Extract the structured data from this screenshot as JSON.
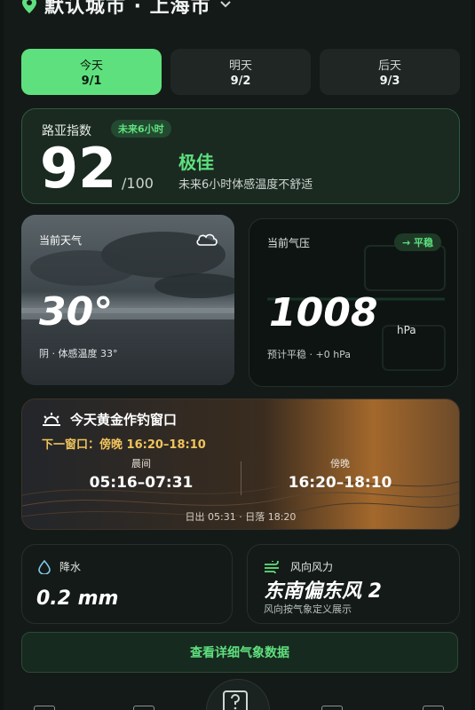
{
  "header": {
    "city": "默认城市 · 上海市"
  },
  "date_tabs": [
    {
      "label": "今天",
      "date": "9/1",
      "active": true
    },
    {
      "label": "明天",
      "date": "9/2",
      "active": false
    },
    {
      "label": "后天",
      "date": "9/3",
      "active": false
    }
  ],
  "lure_index": {
    "title": "路亚指数",
    "badge": "未来6小时",
    "score": "92",
    "max": "/100",
    "rating": "极佳",
    "description": "未来6小时体感温度不舒适"
  },
  "current_weather": {
    "label": "当前天气",
    "temperature": "30°",
    "summary": "阴 · 体感温度 33°",
    "icon": "cloud-icon"
  },
  "pressure": {
    "label": "当前气压",
    "trend": "→ 平稳",
    "value": "1008",
    "unit": "hPa",
    "forecast": "预计平稳 · +0 hPa"
  },
  "golden_window": {
    "title": "今天黄金作钓窗口",
    "next_window": "下一窗口：傍晚 16:20–18:10",
    "morning_label": "晨间",
    "morning_time": "05:16–07:31",
    "evening_label": "傍晚",
    "evening_time": "16:20–18:10",
    "sun_times": "日出 05:31 · 日落 18:20",
    "icon": "sunrise-icon"
  },
  "precipitation": {
    "label": "降水",
    "value": "0.2 mm",
    "icon": "water-drop-icon"
  },
  "wind": {
    "label": "风向风力",
    "value": "东南偏东风 2",
    "note": "风向按气象定义展示",
    "icon": "wind-icon"
  },
  "detail_button": {
    "label": "查看详细气象数据"
  },
  "bottom_nav": {
    "center_icon": "help-question-icon"
  },
  "colors": {
    "accent": "#5fe07e",
    "gold": "#f0c45c",
    "background": "#141a18"
  }
}
